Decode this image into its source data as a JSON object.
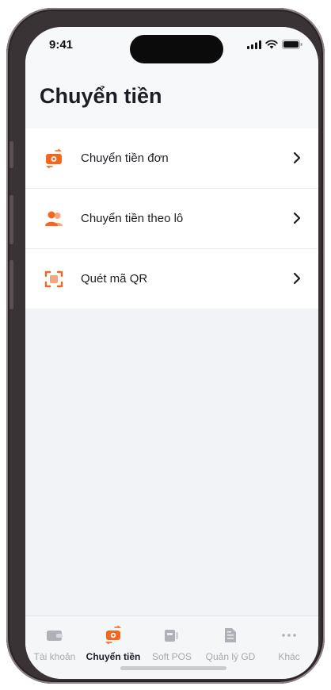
{
  "status": {
    "time": "9:41"
  },
  "page": {
    "title": "Chuyển tiền"
  },
  "menu": {
    "items": [
      {
        "label": "Chuyển tiền đơn",
        "icon": "wallet-transfer-icon"
      },
      {
        "label": "Chuyển tiền theo lô",
        "icon": "users-icon"
      },
      {
        "label": "Quét mã QR",
        "icon": "qr-scan-icon"
      }
    ]
  },
  "tabbar": {
    "items": [
      {
        "label": "Tài khoản",
        "icon": "wallet-icon",
        "active": false
      },
      {
        "label": "Chuyển tiền",
        "icon": "transfer-icon",
        "active": true
      },
      {
        "label": "Soft POS",
        "icon": "pos-icon",
        "active": false
      },
      {
        "label": "Quản lý GD",
        "icon": "document-icon",
        "active": false
      },
      {
        "label": "Khác",
        "icon": "more-icon",
        "active": false
      }
    ]
  },
  "colors": {
    "accent": "#f2661f",
    "inactive_tab": "#a6a9af",
    "text_dark": "#1b1e24"
  }
}
